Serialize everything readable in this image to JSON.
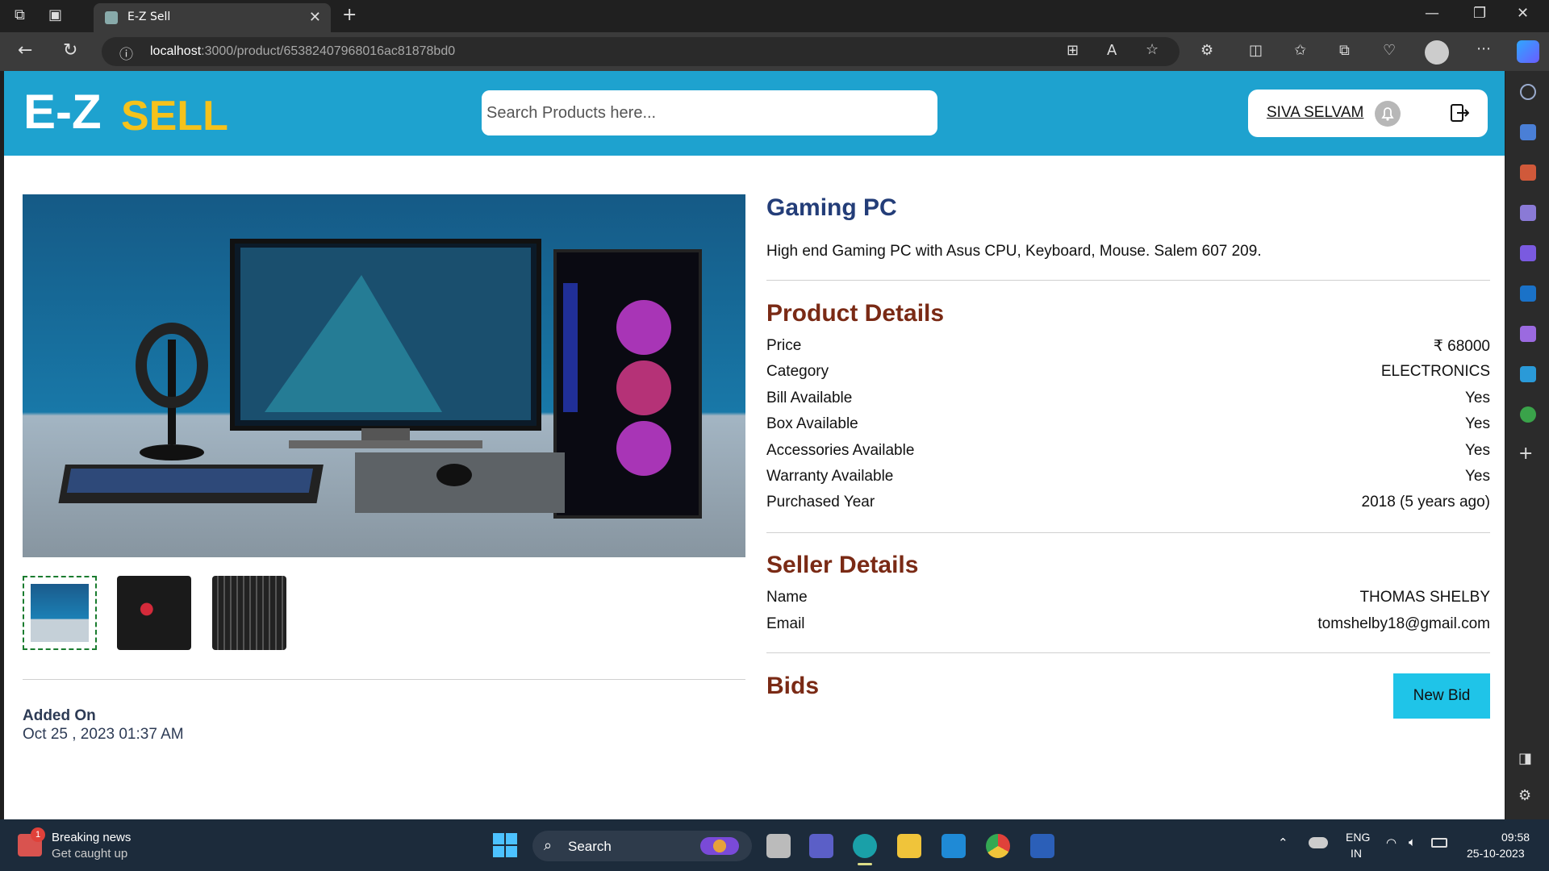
{
  "browser": {
    "tab_title": "E-Z Sell",
    "url_host": "localhost",
    "url_path": ":3000/product/65382407968016ac81878bd0"
  },
  "header": {
    "logo_primary": "E-Z",
    "logo_secondary": "SELL",
    "search_placeholder": "Search Products here...",
    "user_name": "SIVA SELVAM"
  },
  "product": {
    "title": "Gaming PC",
    "description": "High end Gaming PC with Asus CPU, Keyboard, Mouse. Salem 607 209.",
    "added_on_label": "Added On",
    "added_on_value": "Oct 25 , 2023 01:37 AM"
  },
  "product_details": {
    "heading": "Product Details",
    "rows": [
      {
        "label": "Price",
        "value": "₹ 68000"
      },
      {
        "label": "Category",
        "value": "ELECTRONICS"
      },
      {
        "label": "Bill Available",
        "value": "Yes"
      },
      {
        "label": "Box Available",
        "value": "Yes"
      },
      {
        "label": "Accessories Available",
        "value": "Yes"
      },
      {
        "label": "Warranty Available",
        "value": "Yes"
      },
      {
        "label": "Purchased Year",
        "value": "2018 (5 years ago)"
      }
    ]
  },
  "seller_details": {
    "heading": "Seller Details",
    "rows": [
      {
        "label": "Name",
        "value": "THOMAS SHELBY"
      },
      {
        "label": "Email",
        "value": "tomshelby18@gmail.com"
      }
    ]
  },
  "bids": {
    "heading": "Bids",
    "new_bid_label": "New Bid"
  },
  "taskbar": {
    "news_title": "Breaking news",
    "news_subtitle": "Get caught up",
    "news_badge": "1",
    "search_label": "Search",
    "lang_top": "ENG",
    "lang_bottom": "IN",
    "time": "09:58",
    "date": "25-10-2023"
  },
  "colors": {
    "header_bg": "#1ea2cf",
    "logo_accent": "#f5c21b",
    "title_color": "#233d78",
    "section_color": "#7a2a15",
    "bid_button": "#1fc4e8"
  }
}
